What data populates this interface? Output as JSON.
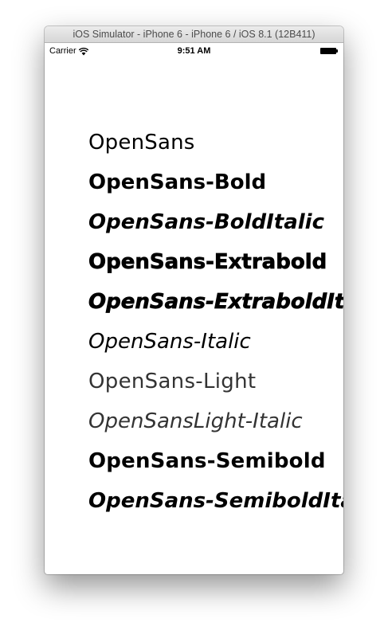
{
  "window": {
    "title": "iOS Simulator - iPhone 6 - iPhone 6 / iOS 8.1 (12B411)"
  },
  "status_bar": {
    "carrier": "Carrier",
    "time": "9:51 AM",
    "wifi_icon": "wifi-icon",
    "battery_icon": "battery-icon",
    "battery_level": 1.0
  },
  "font_list": [
    "OpenSans",
    "OpenSans-Bold",
    "OpenSans-BoldItalic",
    "OpenSans-Extrabold",
    "OpenSans-ExtraboldIt",
    "OpenSans-Italic",
    "OpenSans-Light",
    "OpenSansLight-Italic",
    "OpenSans-Semibold",
    "OpenSans-SemiboldItali"
  ]
}
